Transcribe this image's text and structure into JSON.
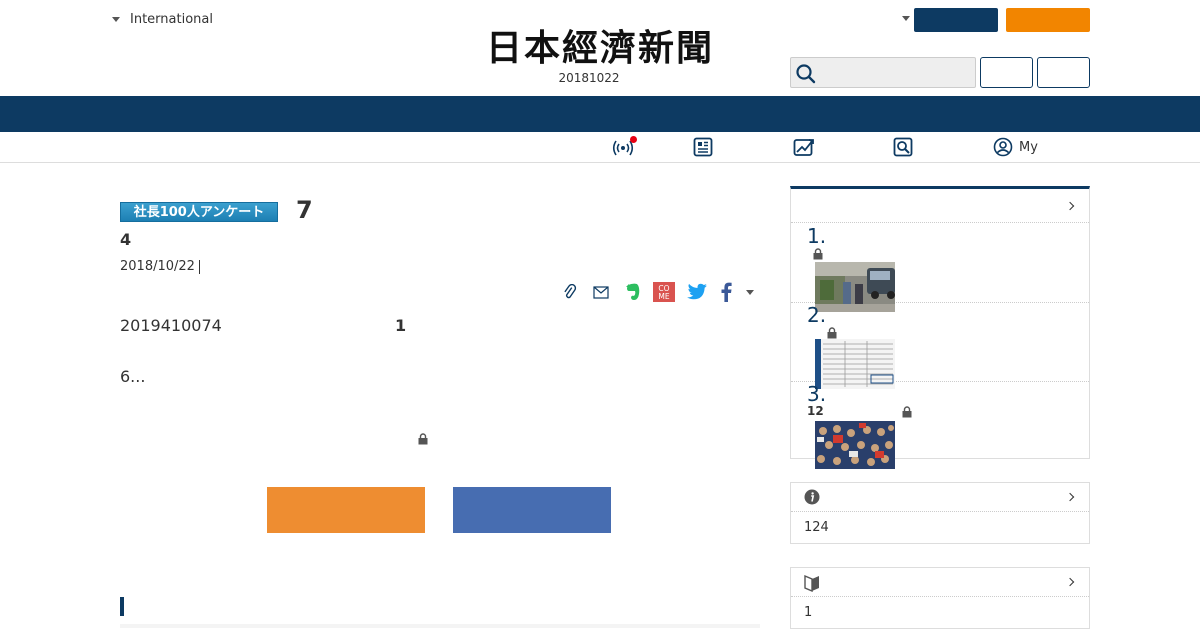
{
  "header": {
    "edition_label": "International",
    "logo_text": "日本經濟新聞",
    "date": "20181022",
    "search": {
      "placeholder": "",
      "value": ""
    }
  },
  "subnav": {
    "my_label": "My"
  },
  "article": {
    "series_label": "社長100人アンケート",
    "title_number": "7",
    "subtitle_number": "4",
    "pub_date": "2018/10/22",
    "body_line1_a": "2019410074",
    "body_line1_b": "1",
    "body_line2": "6..."
  },
  "sidebar": {
    "ranking": {
      "items": [
        {
          "number": "1."
        },
        {
          "number": "2."
        },
        {
          "number": "3.",
          "sub": "12"
        }
      ]
    },
    "info_panel": {
      "value": "124"
    },
    "guide_panel": {
      "value": "1"
    }
  },
  "colors": {
    "navy": "#0d3a62",
    "orange": "#f28500",
    "cta_orange": "#ee8d31",
    "cta_blue": "#476db1",
    "alert_dot": "#e60012"
  },
  "icons": [
    "caret-down-icon",
    "search-icon",
    "live-icon",
    "newspaper-icon",
    "chart-icon",
    "search-magnifier-icon",
    "user-icon",
    "clip-icon",
    "mail-icon",
    "evernote-icon",
    "come-icon",
    "twitter-icon",
    "facebook-icon",
    "lock-icon",
    "info-icon",
    "beginner-icon",
    "chevron-right-icon"
  ]
}
